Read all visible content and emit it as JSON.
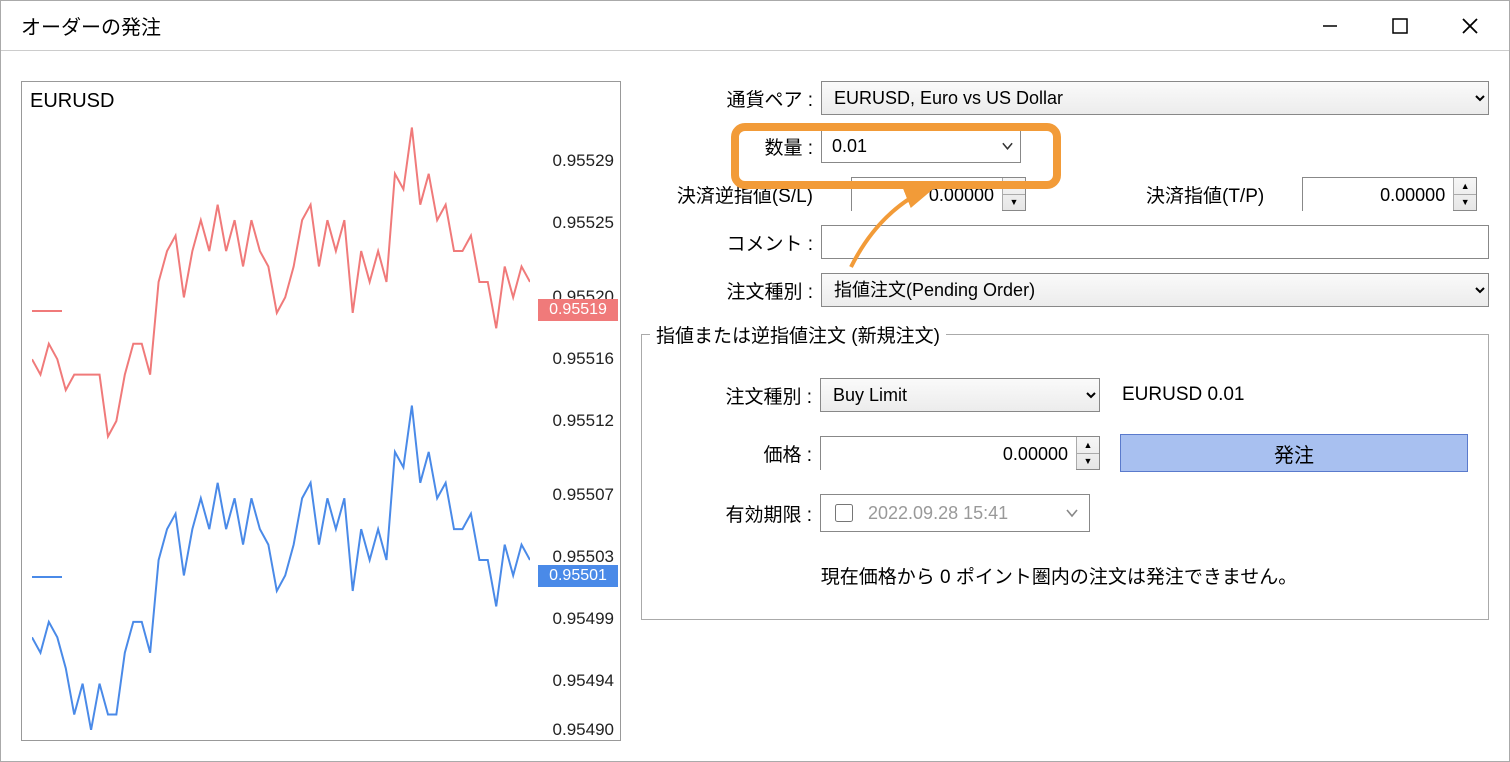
{
  "window": {
    "title": "オーダーの発注"
  },
  "chart": {
    "symbol": "EURUSD",
    "ticks": [
      {
        "v": "0.95529",
        "pct": 8
      },
      {
        "v": "0.95525",
        "pct": 18
      },
      {
        "v": "0.95520",
        "pct": 30
      },
      {
        "v": "0.95516",
        "pct": 40
      },
      {
        "v": "0.95512",
        "pct": 50
      },
      {
        "v": "0.95507",
        "pct": 62
      },
      {
        "v": "0.95503",
        "pct": 72
      },
      {
        "v": "0.95499",
        "pct": 82
      },
      {
        "v": "0.95494",
        "pct": 92
      },
      {
        "v": "0.95490",
        "pct": 100
      }
    ],
    "ask_tag": "0.95519",
    "bid_tag": "0.95501",
    "ask_pct": 32,
    "bid_pct": 75
  },
  "form": {
    "pair_label": "通貨ペア :",
    "pair_value": "EURUSD, Euro vs US Dollar",
    "qty_label": "数量 :",
    "qty_value": "0.01",
    "sl_label": "決済逆指値(S/L)",
    "sl_value": "0.00000",
    "tp_label": "決済指値(T/P)",
    "tp_value": "0.00000",
    "comment_label": "コメント :",
    "comment_value": "",
    "type_label": "注文種別 :",
    "type_value": "指値注文(Pending Order)"
  },
  "pending": {
    "legend": "指値または逆指値注文 (新規注文)",
    "type_label": "注文種別 :",
    "type_value": "Buy Limit",
    "summary": "EURUSD 0.01",
    "price_label": "価格 :",
    "price_value": "0.00000",
    "submit_label": "発注",
    "expiry_label": "有効期限 :",
    "expiry_value": "2022.09.28 15:41",
    "note": "現在価格から 0 ポイント圏内の注文は発注できません。"
  },
  "chart_data": {
    "type": "line",
    "series": [
      {
        "name": "ask",
        "color": "#f07a7a",
        "values": [
          0.95514,
          0.95513,
          0.95515,
          0.95514,
          0.95512,
          0.95513,
          0.95513,
          0.95513,
          0.95513,
          0.95509,
          0.9551,
          0.95513,
          0.95515,
          0.95515,
          0.95513,
          0.95519,
          0.95521,
          0.95522,
          0.95518,
          0.95521,
          0.95523,
          0.95521,
          0.95524,
          0.95521,
          0.95523,
          0.9552,
          0.95523,
          0.95521,
          0.9552,
          0.95517,
          0.95518,
          0.9552,
          0.95523,
          0.95524,
          0.9552,
          0.95523,
          0.95521,
          0.95523,
          0.95517,
          0.95521,
          0.95519,
          0.95521,
          0.95519,
          0.95526,
          0.95525,
          0.95529,
          0.95524,
          0.95526,
          0.95523,
          0.95524,
          0.95521,
          0.95521,
          0.95522,
          0.95519,
          0.95519,
          0.95516,
          0.9552,
          0.95518,
          0.9552,
          0.95519
        ]
      },
      {
        "name": "bid",
        "color": "#4a8ae8",
        "values": [
          0.95496,
          0.95495,
          0.95497,
          0.95496,
          0.95494,
          0.95491,
          0.95493,
          0.9549,
          0.95493,
          0.95491,
          0.95491,
          0.95495,
          0.95497,
          0.95497,
          0.95495,
          0.95501,
          0.95503,
          0.95504,
          0.955,
          0.95503,
          0.95505,
          0.95503,
          0.95506,
          0.95503,
          0.95505,
          0.95502,
          0.95505,
          0.95503,
          0.95502,
          0.95499,
          0.955,
          0.95502,
          0.95505,
          0.95506,
          0.95502,
          0.95505,
          0.95503,
          0.95505,
          0.95499,
          0.95503,
          0.95501,
          0.95503,
          0.95501,
          0.95508,
          0.95507,
          0.95511,
          0.95506,
          0.95508,
          0.95505,
          0.95506,
          0.95503,
          0.95503,
          0.95504,
          0.95501,
          0.95501,
          0.95498,
          0.95502,
          0.955,
          0.95502,
          0.95501
        ]
      }
    ],
    "ylim": [
      0.9549,
      0.9553
    ]
  }
}
